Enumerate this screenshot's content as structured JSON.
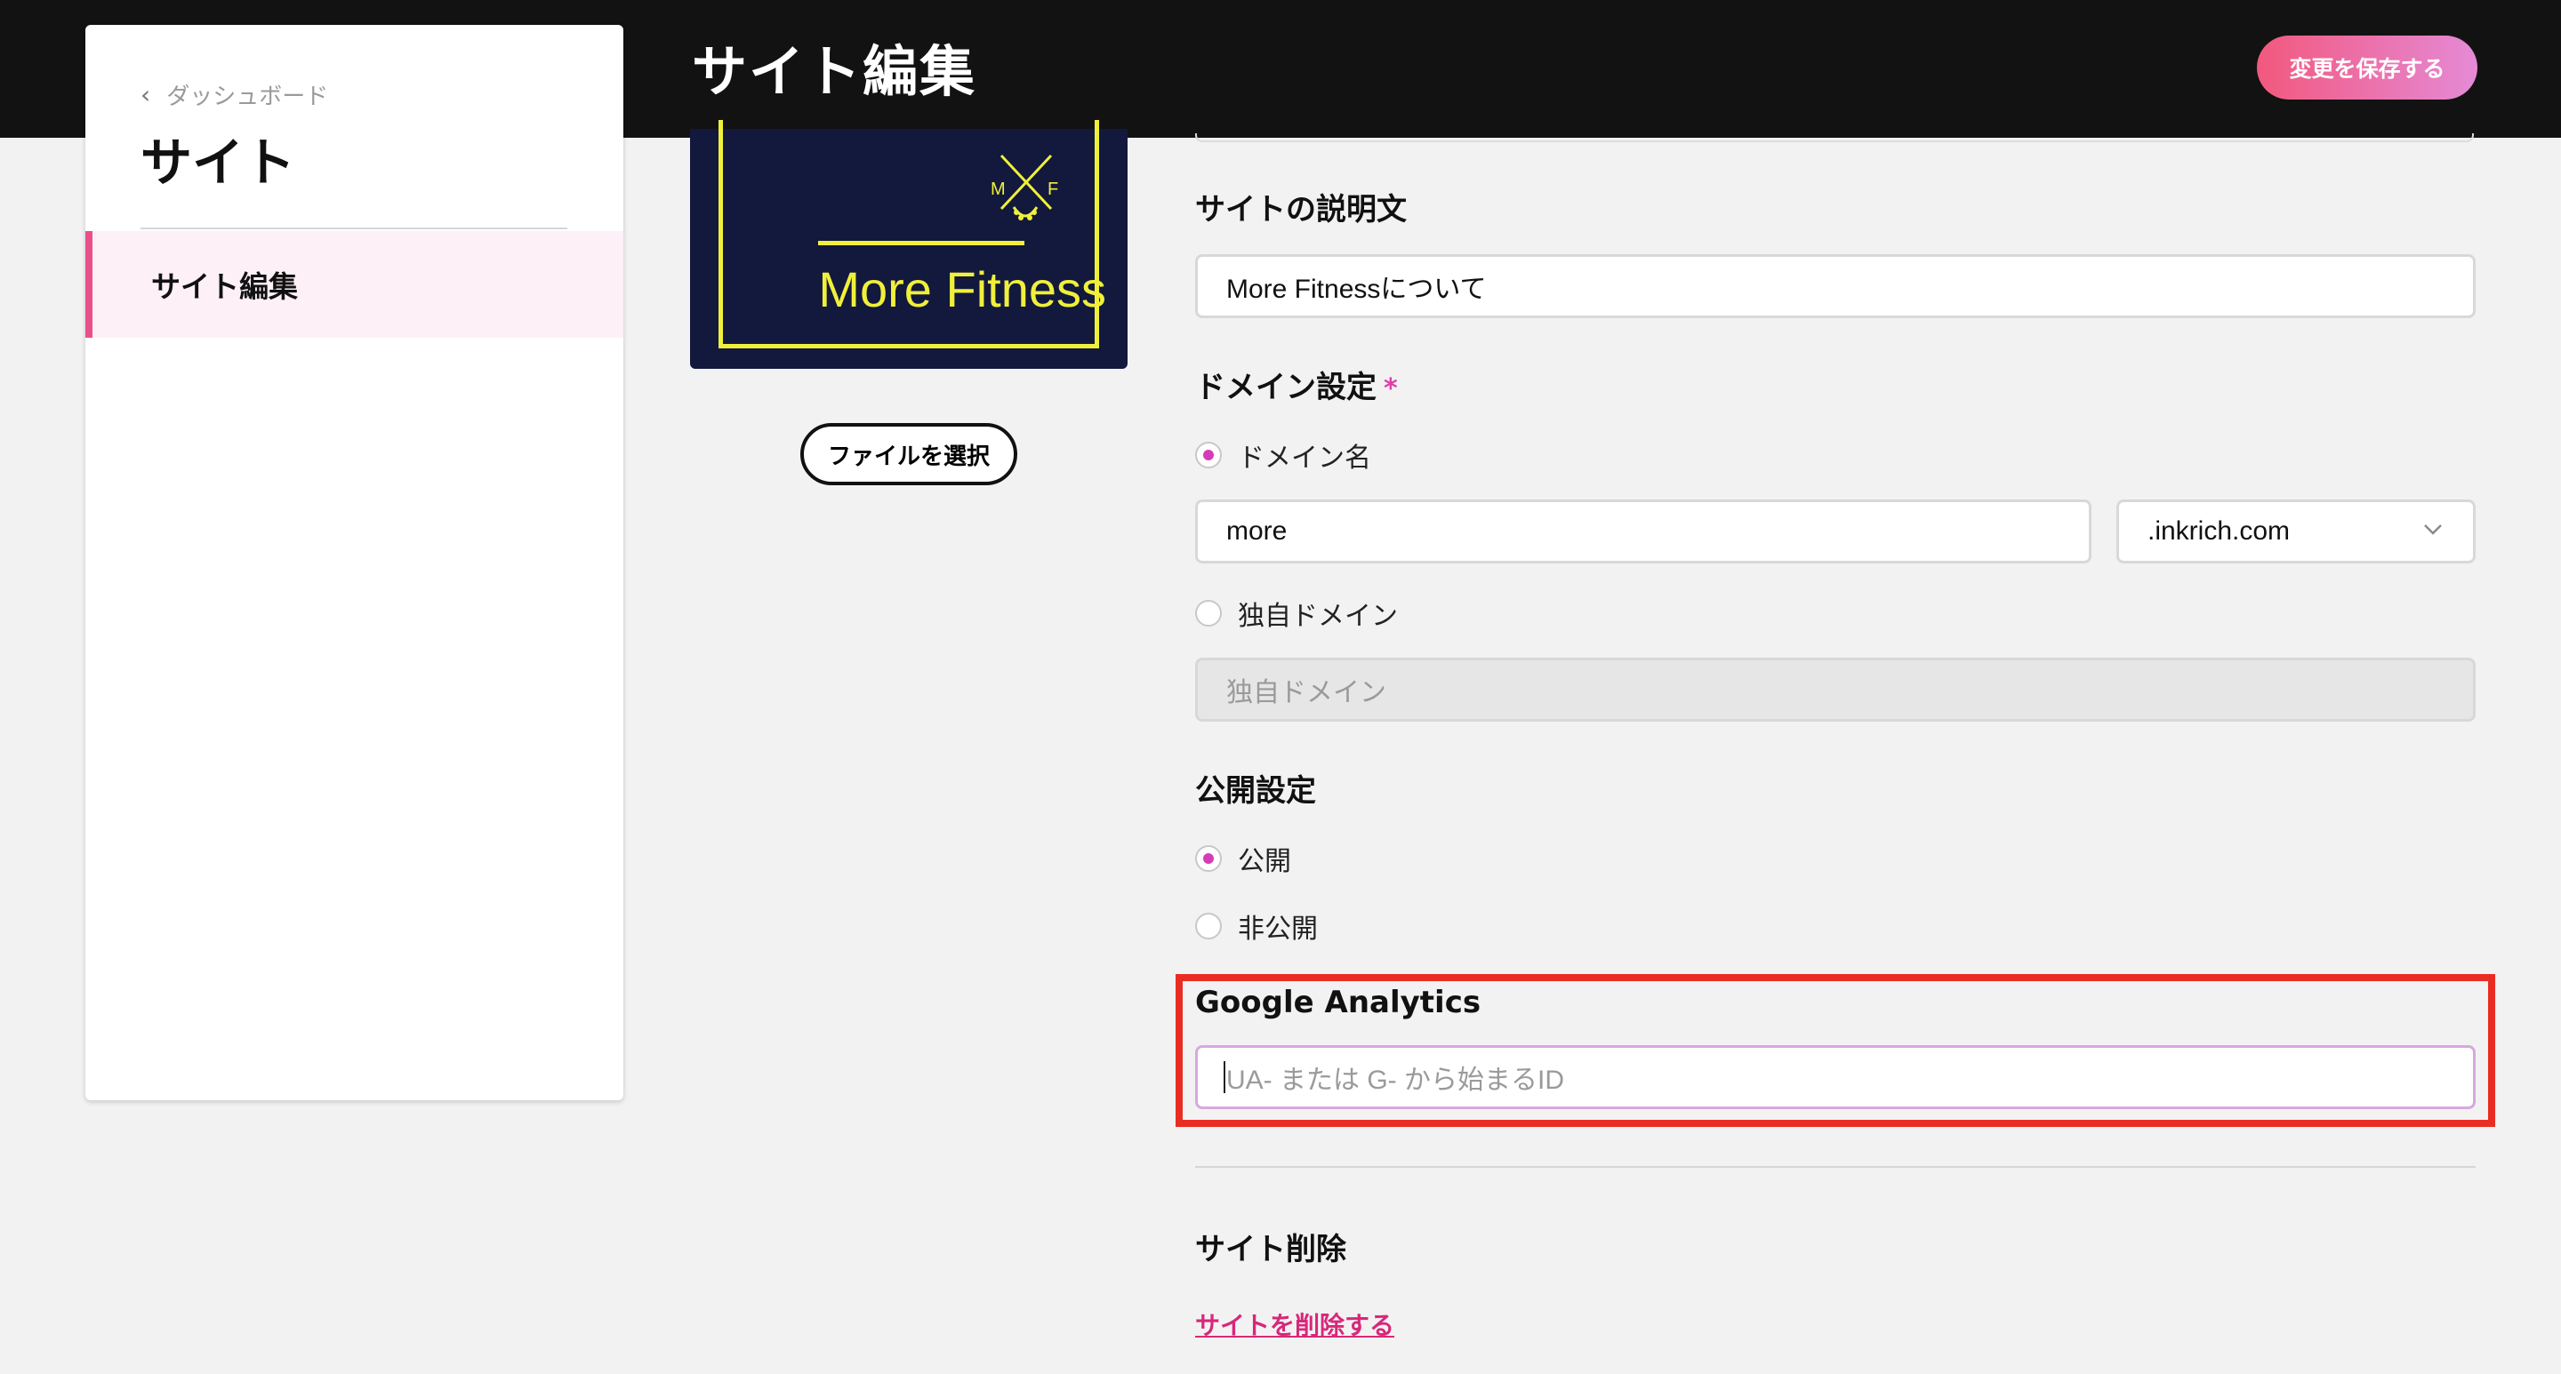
{
  "header": {
    "page_title": "サイト編集",
    "save_button": "変更を保存する"
  },
  "sidebar": {
    "back_label": "ダッシュボード",
    "title": "サイト",
    "items": [
      {
        "label": "サイト編集",
        "active": true
      }
    ]
  },
  "logo": {
    "text": "More Fitness",
    "mark_letters": [
      "M",
      "F"
    ],
    "file_button": "ファイルを選択"
  },
  "form": {
    "description_label": "サイトの説明文",
    "description_value": "More Fitnessについて",
    "domain_label": "ドメイン設定",
    "domain_required_mark": "*",
    "domain_option_name": "ドメイン名",
    "domain_value": "more",
    "domain_suffix": ".inkrich.com",
    "custom_domain_option": "独自ドメイン",
    "custom_domain_placeholder": "独自ドメイン",
    "visibility_label": "公開設定",
    "visibility_public": "公開",
    "visibility_private": "非公開",
    "analytics_label": "Google Analytics",
    "analytics_placeholder": "UA- または G- から始まるID",
    "delete_label": "サイト削除",
    "delete_link": "サイトを削除する"
  },
  "colors": {
    "accent_pink": "#ea4f8c",
    "radio_selected": "#d63cb8",
    "highlight_red": "#ea2d22",
    "logo_bg": "#12193d",
    "logo_yellow": "#f0f03a"
  }
}
